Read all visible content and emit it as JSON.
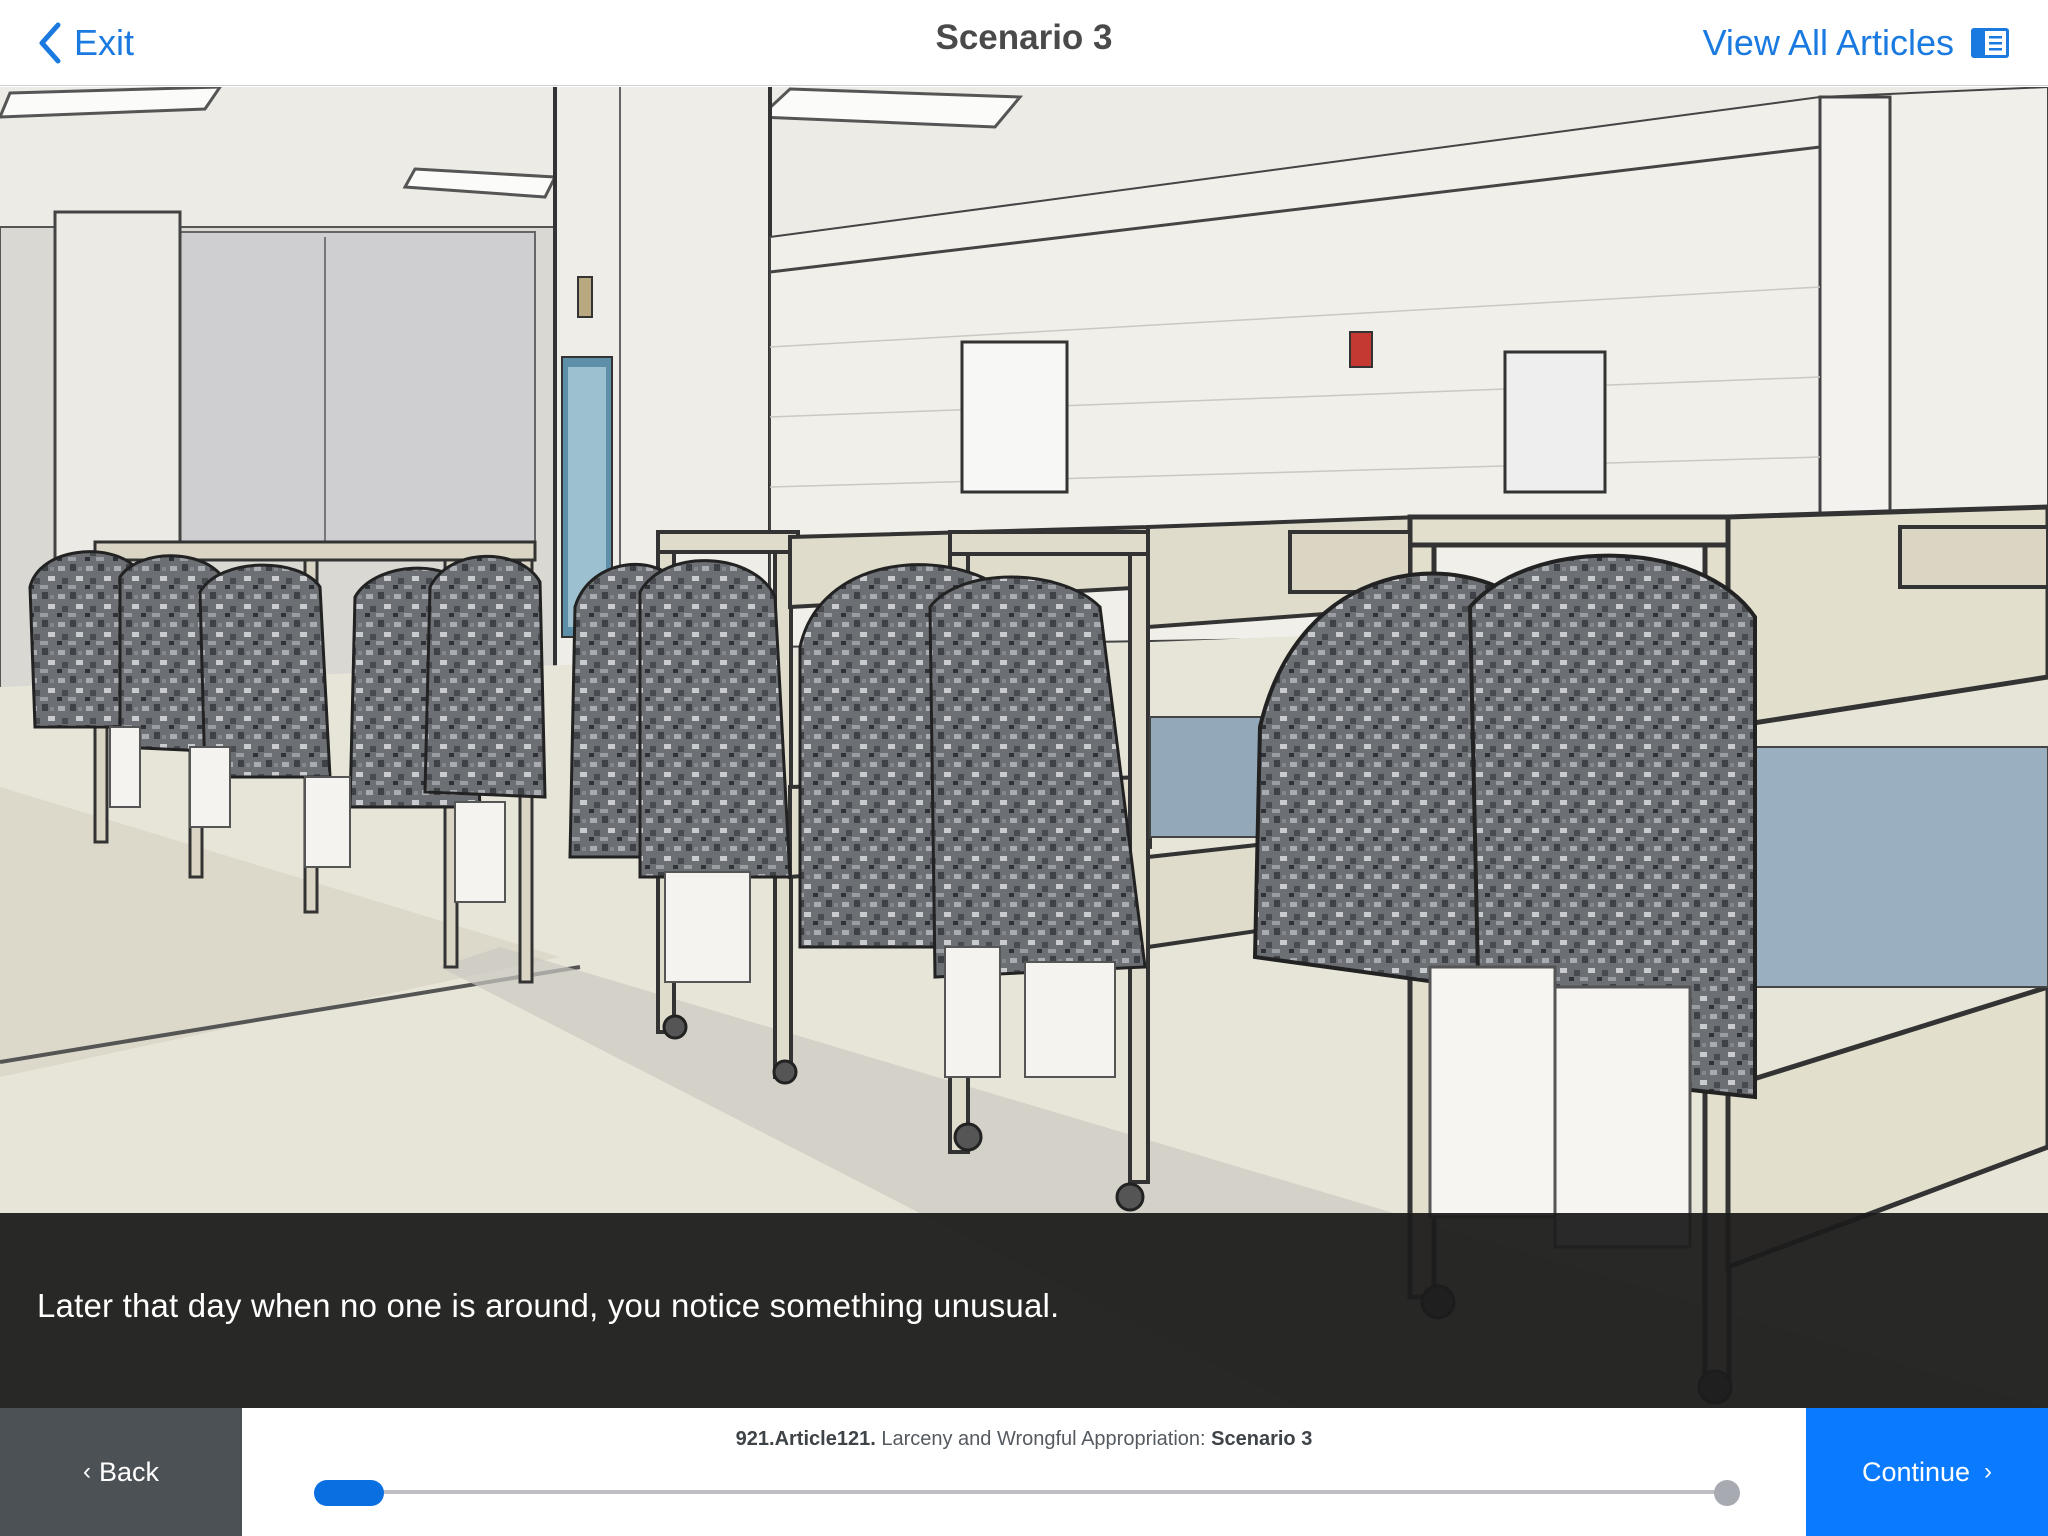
{
  "header": {
    "exit_label": "Exit",
    "title": "Scenario 3",
    "view_all_label": "View All Articles"
  },
  "scene": {
    "caption": "Later that day when no one is around, you notice something unusual."
  },
  "footer": {
    "back_label": "Back",
    "continue_label": "Continue",
    "breadcrumb": {
      "code": "921.Article121.",
      "article": " Larceny and Wrongful Appropriation: ",
      "scenario": "Scenario 3"
    },
    "progress": 0.04
  },
  "colors": {
    "accent": "#0a7bff",
    "back_bg": "#4c5156",
    "caption_bg": "#1c1c1c"
  },
  "icons": {
    "exit": "chevron-left-icon",
    "articles": "articles-book-icon",
    "back": "chevron-left-icon",
    "continue": "chevron-right-icon"
  }
}
